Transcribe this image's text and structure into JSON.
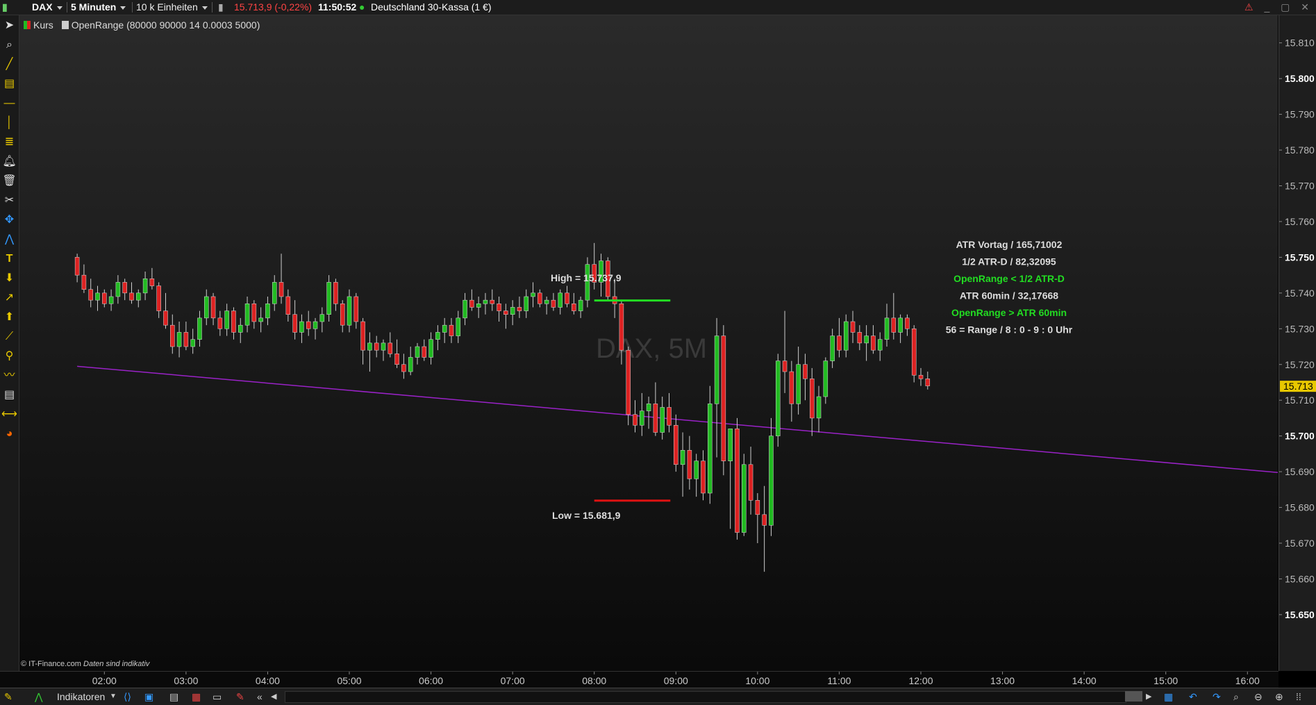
{
  "header": {
    "symbol": "DAX",
    "interval": "5 Minuten",
    "units": "10 k Einheiten",
    "price_change": "15.713,9 (-0,22%)",
    "time": "11:50:52",
    "instrument": "Deutschland 30-Kassa (1 €)"
  },
  "legend": {
    "price_label": "Kurs",
    "indicator_label": "OpenRange (80000 90000 14 0.0003 5000)"
  },
  "watermark": "DAX, 5M",
  "annotations": {
    "high": "High = 15.737,9",
    "low": "Low = 15.681,9"
  },
  "info_panel": [
    {
      "text": "ATR Vortag / 165,71002",
      "color": "#dddddd"
    },
    {
      "text": "1/2 ATR-D / 82,32095",
      "color": "#dddddd"
    },
    {
      "text": "OpenRange < 1/2 ATR-D",
      "color": "#22dd22"
    },
    {
      "text": "ATR 60min / 32,17668",
      "color": "#dddddd"
    },
    {
      "text": "OpenRange > ATR 60min",
      "color": "#22dd22"
    },
    {
      "text": "56  = Range / 8 : 0 - 9 : 0  Uhr",
      "color": "#dddddd"
    }
  ],
  "current_price_tag": "15.713",
  "copyright": "© IT-Finance.com",
  "copyright_note": "Daten sind indikativ",
  "bottom": {
    "indicators_label": "Indikatoren"
  },
  "colors": {
    "up": "#22bb22",
    "down": "#dd2222",
    "trendline": "#9a22c8",
    "high_line": "#22dd22",
    "low_line": "#dd1111",
    "price_tag_bg": "#e8c800"
  },
  "chart_data": {
    "type": "candlestick",
    "x_tick_labels": [
      "02:00",
      "03:00",
      "04:00",
      "05:00",
      "06:00",
      "07:00",
      "08:00",
      "09:00",
      "10:00",
      "11:00",
      "12:00",
      "13:00",
      "14:00",
      "15:00",
      "16:00"
    ],
    "y_tick_labels": [
      "15.810",
      "15.800",
      "15.790",
      "15.780",
      "15.770",
      "15.760",
      "15.750",
      "15.740",
      "15.730",
      "15.720",
      "15.710",
      "15.700",
      "15.690",
      "15.680",
      "15.670",
      "15.660",
      "15.650"
    ],
    "ylim": [
      15646,
      15813
    ],
    "xlim_hours": [
      1.55,
      16.5
    ],
    "bar_minutes": 5,
    "start_time": "01:40",
    "opening_range": {
      "start": "08:00",
      "end": "09:00",
      "high": 15737.9,
      "low": 15681.9
    },
    "trendline": {
      "start": [
        "01:40",
        15719.5
      ],
      "end": [
        "17:00",
        15688.5
      ]
    },
    "candles_ohlc": [
      [
        15750,
        15751,
        15743,
        15745
      ],
      [
        15745,
        15748,
        15740,
        15741
      ],
      [
        15741,
        15744,
        15736,
        15738
      ],
      [
        15738,
        15742,
        15735,
        15740
      ],
      [
        15740,
        15741,
        15736,
        15737
      ],
      [
        15737,
        15741,
        15735,
        15739
      ],
      [
        15739,
        15745,
        15737,
        15743
      ],
      [
        15743,
        15744,
        15738,
        15740
      ],
      [
        15740,
        15743,
        15737,
        15738
      ],
      [
        15738,
        15741,
        15736,
        15740
      ],
      [
        15740,
        15746,
        15738,
        15744
      ],
      [
        15744,
        15747,
        15741,
        15742
      ],
      [
        15742,
        15743,
        15733,
        15735
      ],
      [
        15735,
        15740,
        15730,
        15731
      ],
      [
        15731,
        15734,
        15723,
        15725
      ],
      [
        15725,
        15732,
        15722,
        15729
      ],
      [
        15729,
        15732,
        15724,
        15725
      ],
      [
        15725,
        15730,
        15723,
        15727
      ],
      [
        15727,
        15735,
        15725,
        15733
      ],
      [
        15733,
        15741,
        15731,
        15739
      ],
      [
        15739,
        15740,
        15731,
        15733
      ],
      [
        15733,
        15735,
        15728,
        15730
      ],
      [
        15730,
        15737,
        15728,
        15735
      ],
      [
        15735,
        15736,
        15727,
        15729
      ],
      [
        15729,
        15733,
        15726,
        15731
      ],
      [
        15731,
        15739,
        15729,
        15737
      ],
      [
        15737,
        15738,
        15730,
        15732
      ],
      [
        15732,
        15736,
        15729,
        15733
      ],
      [
        15733,
        15739,
        15731,
        15737
      ],
      [
        15737,
        15745,
        15735,
        15743
      ],
      [
        15743,
        15751,
        15737,
        15739
      ],
      [
        15739,
        15741,
        15732,
        15734
      ],
      [
        15734,
        15738,
        15727,
        15729
      ],
      [
        15729,
        15734,
        15726,
        15732
      ],
      [
        15732,
        15735,
        15728,
        15730
      ],
      [
        15730,
        15733,
        15727,
        15732
      ],
      [
        15732,
        15736,
        15729,
        15734
      ],
      [
        15734,
        15745,
        15732,
        15743
      ],
      [
        15743,
        15744,
        15735,
        15737
      ],
      [
        15737,
        15738,
        15729,
        15731
      ],
      [
        15731,
        15741,
        15729,
        15739
      ],
      [
        15739,
        15740,
        15730,
        15732
      ],
      [
        15732,
        15733,
        15720,
        15724
      ],
      [
        15724,
        15729,
        15718,
        15726
      ],
      [
        15726,
        15728,
        15722,
        15724
      ],
      [
        15724,
        15727,
        15721,
        15726
      ],
      [
        15726,
        15729,
        15722,
        15723
      ],
      [
        15723,
        15727,
        15719,
        15720
      ],
      [
        15720,
        15723,
        15716,
        15718
      ],
      [
        15718,
        15725,
        15717,
        15722
      ],
      [
        15722,
        15726,
        15720,
        15725
      ],
      [
        15725,
        15727,
        15721,
        15722
      ],
      [
        15722,
        15729,
        15720,
        15727
      ],
      [
        15727,
        15731,
        15724,
        15729
      ],
      [
        15729,
        15733,
        15726,
        15731
      ],
      [
        15731,
        15733,
        15726,
        15728
      ],
      [
        15728,
        15735,
        15726,
        15733
      ],
      [
        15733,
        15740,
        15731,
        15738
      ],
      [
        15738,
        15741,
        15735,
        15736
      ],
      [
        15736,
        15739,
        15733,
        15737
      ],
      [
        15737,
        15740,
        15734,
        15738
      ],
      [
        15738,
        15741,
        15735,
        15737
      ],
      [
        15737,
        15739,
        15732,
        15735
      ],
      [
        15735,
        15737,
        15730,
        15734
      ],
      [
        15734,
        15738,
        15731,
        15736
      ],
      [
        15736,
        15739,
        15733,
        15735
      ],
      [
        15735,
        15741,
        15733,
        15739
      ],
      [
        15739,
        15743,
        15736,
        15740
      ],
      [
        15740,
        15741,
        15736,
        15737
      ],
      [
        15737,
        15739,
        15734,
        15738
      ],
      [
        15738,
        15740,
        15735,
        15736
      ],
      [
        15736,
        15741,
        15734,
        15740
      ],
      [
        15740,
        15742,
        15736,
        15737
      ],
      [
        15737,
        15740,
        15734,
        15735
      ],
      [
        15735,
        15739,
        15733,
        15738
      ],
      [
        15738,
        15750,
        15736,
        15748
      ],
      [
        15748,
        15754,
        15741,
        15743
      ],
      [
        15743,
        15751,
        15739,
        15749
      ],
      [
        15749,
        15750,
        15738,
        15739
      ],
      [
        15739,
        15744,
        15733,
        15737
      ],
      [
        15737,
        15738,
        15720,
        15724
      ],
      [
        15724,
        15725,
        15703,
        15706
      ],
      [
        15706,
        15710,
        15701,
        15703
      ],
      [
        15703,
        15712,
        15700,
        15707
      ],
      [
        15707,
        15711,
        15702,
        15709
      ],
      [
        15709,
        15715,
        15700,
        15701
      ],
      [
        15701,
        15711,
        15699,
        15708
      ],
      [
        15708,
        15712,
        15701,
        15703
      ],
      [
        15703,
        15706,
        15690,
        15692
      ],
      [
        15692,
        15701,
        15683,
        15696
      ],
      [
        15696,
        15700,
        15685,
        15688
      ],
      [
        15688,
        15695,
        15683,
        15693
      ],
      [
        15693,
        15696,
        15682,
        15684
      ],
      [
        15684,
        15714,
        15681,
        15709
      ],
      [
        15709,
        15733,
        15694,
        15728
      ],
      [
        15728,
        15731,
        15689,
        15693
      ],
      [
        15693,
        15702,
        15674,
        15702
      ],
      [
        15702,
        15705,
        15671,
        15673
      ],
      [
        15673,
        15695,
        15672,
        15692
      ],
      [
        15692,
        15697,
        15678,
        15682
      ],
      [
        15682,
        15684,
        15670,
        15678
      ],
      [
        15678,
        15686,
        15662,
        15675
      ],
      [
        15675,
        15705,
        15672,
        15700
      ],
      [
        15700,
        15723,
        15697,
        15721
      ],
      [
        15721,
        15735,
        15712,
        15718
      ],
      [
        15718,
        15721,
        15704,
        15709
      ],
      [
        15709,
        15725,
        15706,
        15720
      ],
      [
        15720,
        15723,
        15710,
        15716
      ],
      [
        15716,
        15719,
        15700,
        15705
      ],
      [
        15705,
        15714,
        15701,
        15711
      ],
      [
        15711,
        15722,
        15709,
        15721
      ],
      [
        15721,
        15730,
        15719,
        15728
      ],
      [
        15728,
        15733,
        15722,
        15724
      ],
      [
        15724,
        15734,
        15722,
        15732
      ],
      [
        15732,
        15735,
        15726,
        15729
      ],
      [
        15729,
        15731,
        15724,
        15726
      ],
      [
        15726,
        15731,
        15721,
        15728
      ],
      [
        15728,
        15731,
        15723,
        15724
      ],
      [
        15724,
        15729,
        15721,
        15727
      ],
      [
        15727,
        15737,
        15725,
        15733
      ],
      [
        15733,
        15740,
        15727,
        15729
      ],
      [
        15729,
        15734,
        15726,
        15733
      ],
      [
        15733,
        15734,
        15728,
        15730
      ],
      [
        15730,
        15731,
        15715,
        15717
      ],
      [
        15717,
        15719,
        15714,
        15716
      ],
      [
        15716,
        15718,
        15713,
        15714
      ]
    ]
  }
}
